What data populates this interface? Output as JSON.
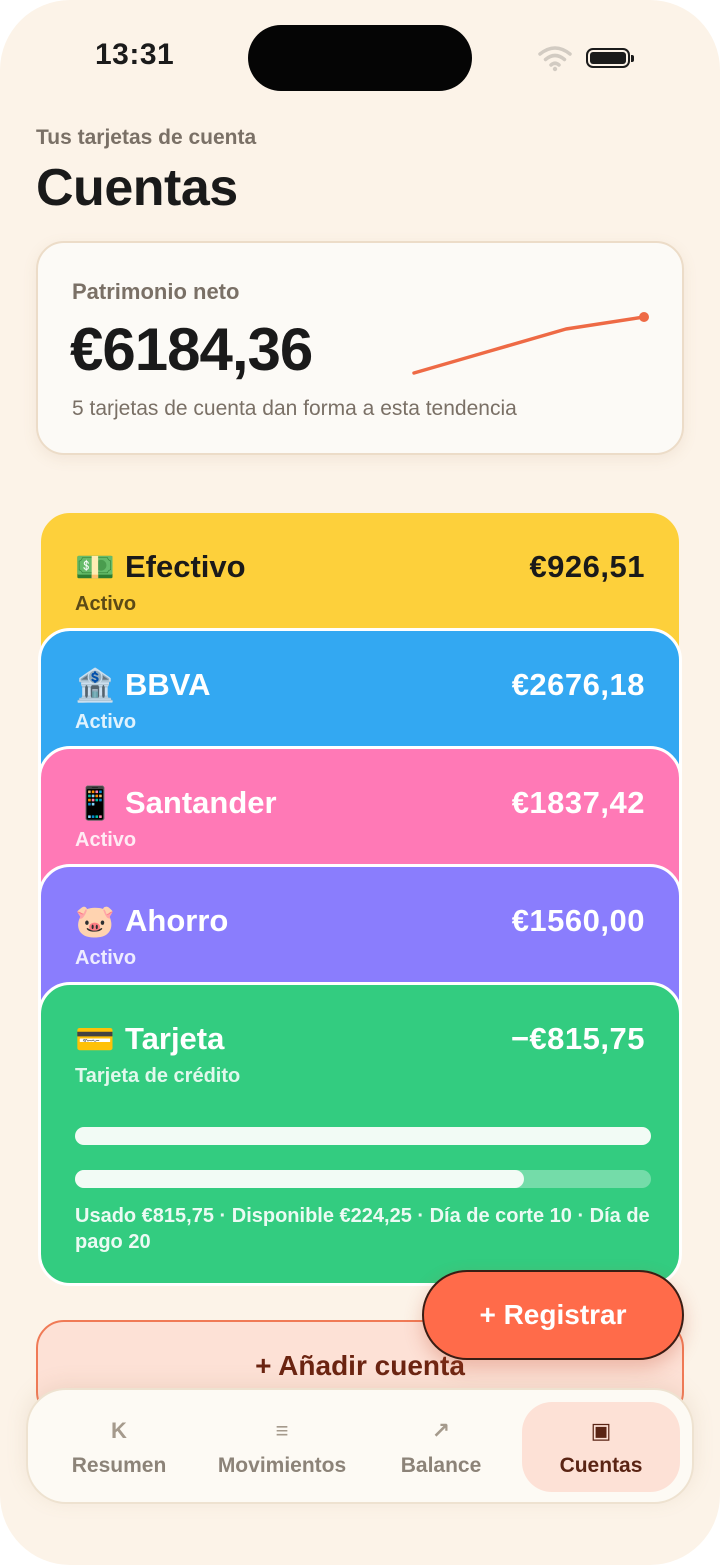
{
  "status_bar": {
    "time": "13:31"
  },
  "header": {
    "eyebrow": "Tus tarjetas de cuenta",
    "title": "Cuentas"
  },
  "net_worth": {
    "label": "Patrimonio neto",
    "value": "€6184,36",
    "subtitle": "5 tarjetas de cuenta dan forma a esta tendencia",
    "trend_color": "#ee6a45"
  },
  "accounts": [
    {
      "emoji": "💵",
      "name": "Efectivo",
      "amount": "€926,51",
      "type": "Activo",
      "color": "#fdd03b"
    },
    {
      "emoji": "🏦",
      "name": "BBVA",
      "amount": "€2676,18",
      "type": "Activo",
      "color": "#33a8f2"
    },
    {
      "emoji": "📱",
      "name": "Santander",
      "amount": "€1837,42",
      "type": "Activo",
      "color": "#ff79b6"
    },
    {
      "emoji": "🐷",
      "name": "Ahorro",
      "amount": "€1560,00",
      "type": "Activo",
      "color": "#8a7dfd"
    },
    {
      "emoji": "💳",
      "name": "Tarjeta",
      "amount": "−€815,75",
      "type": "Tarjeta de crédito",
      "color": "#33cc80",
      "usage_fraction": 0.78,
      "footer": "Usado €815,75 · Disponible €224,25 · Día de corte 10 · Día de pago 20"
    }
  ],
  "add_account": {
    "label": "+ Añadir cuenta"
  },
  "fab": {
    "label": "+ Registrar"
  },
  "tabs": [
    {
      "icon": "K",
      "label": "Resumen"
    },
    {
      "icon": "≡",
      "label": "Movimientos"
    },
    {
      "icon": "↗",
      "label": "Balance"
    },
    {
      "icon": "▣",
      "label": "Cuentas",
      "active": true
    }
  ]
}
